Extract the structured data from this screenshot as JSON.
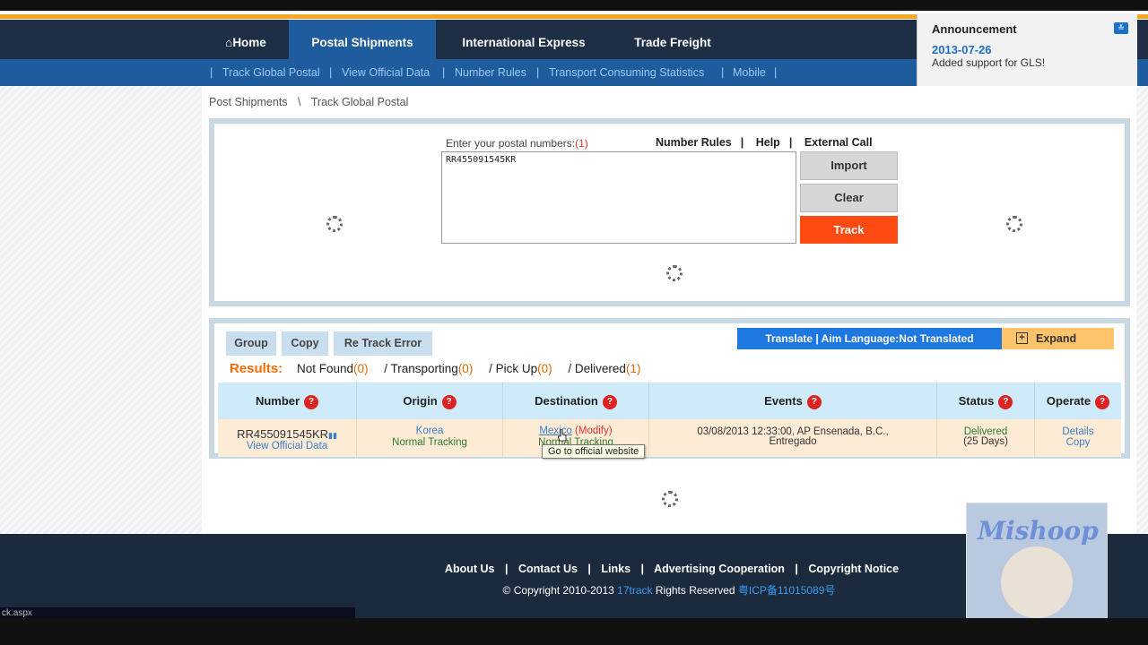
{
  "nav": {
    "home": "Home",
    "items": [
      "Postal Shipments",
      "International Express",
      "Trade Freight"
    ]
  },
  "subnav": [
    "Track Global Postal",
    "View Official Data",
    "Number Rules",
    "Transport Consuming Statistics",
    "Mobile"
  ],
  "announcement": {
    "title": "Announcement",
    "date": "2013-07-26",
    "text": "Added support for GLS!"
  },
  "breadcrumb": {
    "root": "Post Shipments",
    "current": "Track Global Postal"
  },
  "track_form": {
    "label": "Enter your postal numbers:",
    "count": "(1)",
    "links": [
      "Number Rules",
      "Help",
      "External Call"
    ],
    "textarea_value": "RR455091545KR",
    "import_label": "Import",
    "clear_label": "Clear",
    "track_label": "Track"
  },
  "results_toolbar": {
    "buttons": [
      "Group",
      "Copy",
      "Re Track Error"
    ],
    "translate_label": "Translate | Aim Language:Not Translated",
    "expand_label": "Expand"
  },
  "results_summary": {
    "label": "Results:",
    "not_found": "Not Found",
    "not_found_n": "(0)",
    "transporting": "/ Transporting",
    "transporting_n": "(0)",
    "pickup": "/ Pick Up",
    "pickup_n": "(0)",
    "delivered": "/ Delivered",
    "delivered_n": "(1)"
  },
  "table": {
    "headers": [
      "Number",
      "Origin",
      "Destination",
      "Events",
      "Status",
      "Operate"
    ],
    "row": {
      "number": "RR455091545KR",
      "view_official": "View Official Data",
      "origin": "Korea",
      "origin_tracking": "Normal Tracking",
      "destination": "Mexico",
      "modify": "(Modify)",
      "destination_tracking": "Normal Tracking",
      "event_line1": "03/08/2013 12:33:00, AP Ensenada, B.C.,",
      "event_line2": "Entregado",
      "status": "Delivered",
      "days": "(25 Days)",
      "details": "Details",
      "copy": "Copy"
    }
  },
  "tooltip": "Go to official website",
  "footer": {
    "links": [
      "About Us",
      "Contact Us",
      "Links",
      "Advertising Cooperation",
      "Copyright Notice"
    ],
    "copyright": "© Copyright 2010-2013",
    "brand": "17track",
    "rights": "Rights Reserved",
    "icp": "粤ICP备11015089号"
  },
  "statusbar": "ck.aspx",
  "watermark": "Mishoop"
}
